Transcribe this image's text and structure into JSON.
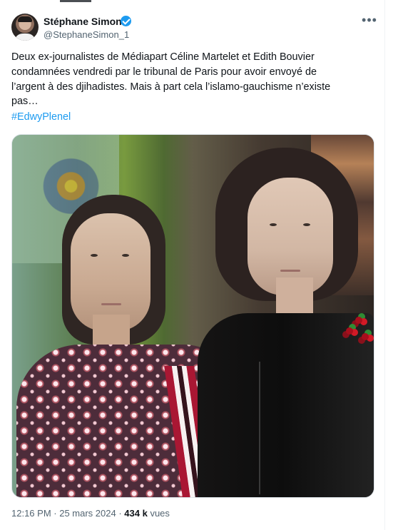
{
  "tweet": {
    "author": {
      "name": "Stéphane Simon",
      "handle": "@StephaneSimon_1",
      "avatar_icon": "profile-photo",
      "verified_icon": "verified-badge-icon"
    },
    "more_label": "•••",
    "text": "Deux ex-journalistes de Médiapart Céline Martelet et Edith Bouvier\ncondamnées vendredi par le tribunal de Paris pour avoir envoyé de\nl’argent à des djihadistes. Mais à part cela l’islamo-gauchisme n’existe\npas…",
    "hashtag": "#EdwyPlenel",
    "image": {
      "type": "photo",
      "alt": ""
    },
    "metadata": {
      "time": "12:16 PM",
      "separator": " · ",
      "date": "25 mars 2024",
      "views_count": "434 k",
      "views_label": "vues"
    }
  },
  "colors": {
    "text": "#0f1419",
    "secondary_text": "#536471",
    "accent": "#1d9bf0",
    "border": "#eff3f4"
  }
}
